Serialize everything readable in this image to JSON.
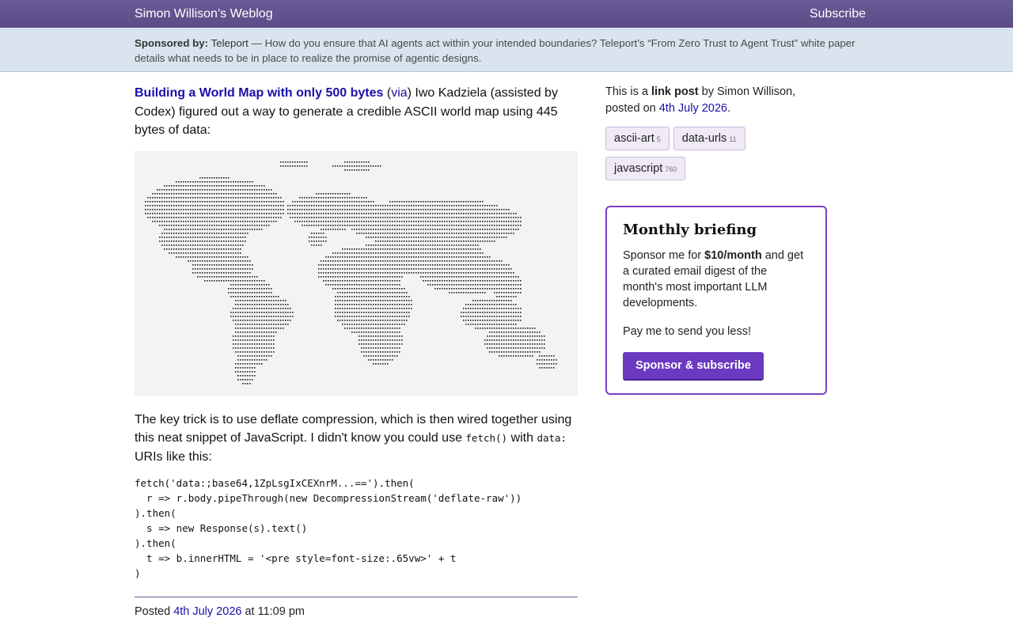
{
  "header": {
    "site_title": "Simon Willison’s Weblog",
    "subscribe_label": "Subscribe"
  },
  "sponsor": {
    "prefix": "Sponsored by:",
    "sponsor_name": "Teleport",
    "message": "— How do you ensure that AI agents act within your intended boundaries? Teleport’s “From Zero Trust to Agent Trust” white paper details what needs to be in place to realize the promise of agentic designs."
  },
  "post": {
    "title": "Building a World Map with only 500 bytes",
    "via_open": "(",
    "via_label": "via",
    "via_close_and_text": ") Iwo Kadziela (assisted by Codex) figured out a way to generate a credible ASCII world map using 445 bytes of data:",
    "p2_a": "The key trick is to use deflate compression, which is then wired together using this neat snippet of JavaScript. I didn't know you could use ",
    "p2_code1": "fetch()",
    "p2_b": " with ",
    "p2_code2": "data:",
    "p2_c": " URIs like this:",
    "code": "fetch('data:;base64,1ZpLsgIxCEXnrM...==').then(\n  r => r.body.pipeThrough(new DecompressionStream('deflate-raw'))\n).then(\n  s => new Response(s).text()\n).then(\n  t => b.innerHTML = '<pre style=font-size:.65vw>' + t\n)",
    "posted_prefix": "Posted",
    "posted_date": "4th July 2026",
    "posted_time": "at 11:09 pm"
  },
  "sidebar": {
    "meta_a": "This is a ",
    "meta_bold": "link post",
    "meta_b": " by Simon Willison, posted on ",
    "meta_date": "4th July 2026",
    "meta_end": ".",
    "tags": [
      {
        "name": "ascii-art",
        "count": "5"
      },
      {
        "name": "data-urls",
        "count": "11"
      },
      {
        "name": "javascript",
        "count": "760"
      }
    ],
    "briefing": {
      "heading": "Monthly briefing",
      "p1_a": "Sponsor me for ",
      "p1_bold": "$10/month",
      "p1_b": " and get a curated email digest of the month's most important LLM developments.",
      "p2": "Pay me to send you less!",
      "button": "Sponsor & subscribe"
    }
  },
  "colors": {
    "header_bg": "#5f4f8c",
    "sponsor_bg": "#d9e4ee",
    "accent": "#6b3ac0",
    "link": "#1a0ea8"
  },
  "icons": {
    "map": "ascii-world-map"
  }
}
